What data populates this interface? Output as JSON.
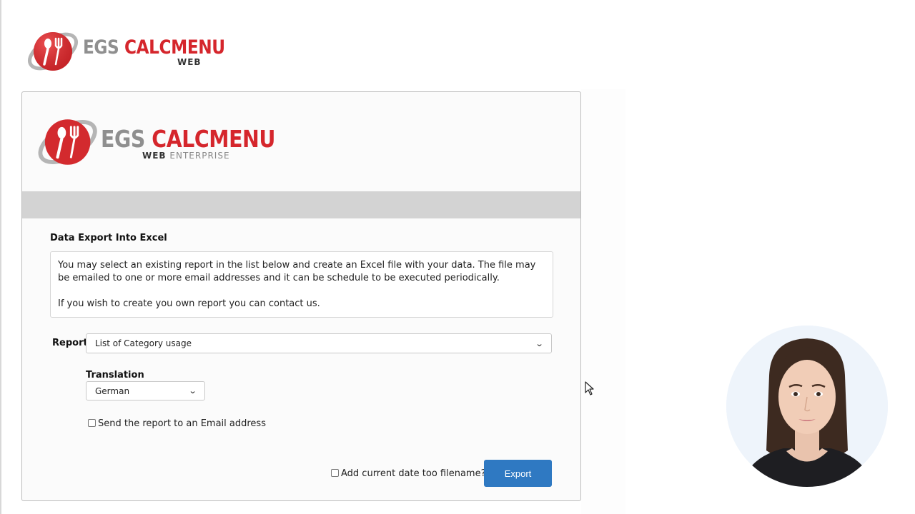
{
  "top_logo": {
    "brand_part1": "EGS",
    "brand_part2": "CALCMENU",
    "sub": "WEB"
  },
  "panel_logo": {
    "brand_part1": "EGS",
    "brand_part2": "CALCMENU",
    "sub_part1": "WEB",
    "sub_part2": "ENTERPRISE"
  },
  "export_form": {
    "title": "Data Export Into Excel",
    "info_line1": "You may select an existing report in the list below and create an Excel file with your data. The file may be emailed to one or more email addresses and it can be schedule to be executed periodically.",
    "info_line2": "If you wish to create you own report you can contact us.",
    "report_label": "Report",
    "report_selected": "List of Category usage",
    "translation_label": "Translation",
    "translation_selected": "German",
    "email_checkbox_label": "Send the report to an Email address",
    "email_checked": false,
    "date_checkbox_label": "Add current date too filename?",
    "date_checked": false,
    "export_button": "Export"
  },
  "colors": {
    "brand_red": "#d5262c",
    "brand_gray": "#8f8f8f",
    "button_blue": "#2f79c2",
    "header_bar": "#d3d3d3"
  }
}
